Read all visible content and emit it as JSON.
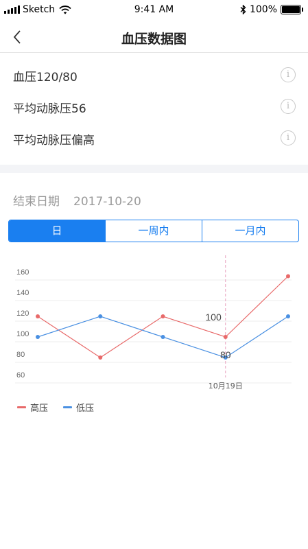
{
  "status_bar": {
    "carrier": "Sketch",
    "time": "9:41 AM",
    "battery": "100%"
  },
  "nav": {
    "title": "血压数据图"
  },
  "info_items": [
    {
      "label": "血压120/80"
    },
    {
      "label": "平均动脉压56"
    },
    {
      "label": "平均动脉压偏高"
    }
  ],
  "end_date": {
    "label": "结束日期",
    "value": "2017-10-20"
  },
  "tabs": [
    {
      "label": "日",
      "active": true
    },
    {
      "label": "一周内",
      "active": false
    },
    {
      "label": "一月内",
      "active": false
    }
  ],
  "chart_data": {
    "type": "line",
    "y_ticks": [
      60,
      80,
      100,
      120,
      140,
      160
    ],
    "ylim": [
      60,
      160
    ],
    "x_index": [
      0,
      1,
      2,
      3,
      4
    ],
    "series": [
      {
        "name": "高压",
        "color": "#e86a6a",
        "values": [
          118,
          78,
          118,
          98,
          157
        ]
      },
      {
        "name": "低压",
        "color": "#4a90e2",
        "values": [
          98,
          118,
          98,
          78,
          118
        ]
      }
    ],
    "highlight": {
      "index": 3,
      "date_label": "10月19日",
      "high_value_label": "100",
      "low_value_label": "80"
    },
    "grid": true
  }
}
